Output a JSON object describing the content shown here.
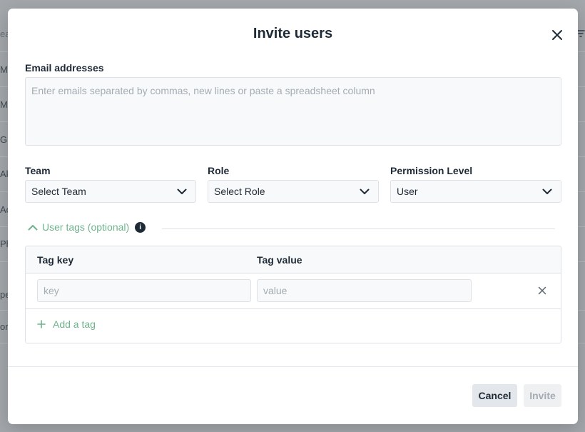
{
  "background": {
    "rows": [
      "eau",
      "Mo",
      "Ma",
      "Gu",
      "Ak",
      "Ac",
      "Ph",
      "pe",
      "on"
    ]
  },
  "modal": {
    "title": "Invite users",
    "email": {
      "label": "Email addresses",
      "placeholder": "Enter emails separated by commas, new lines or paste a spreadsheet column",
      "value": ""
    },
    "team": {
      "label": "Team",
      "value": "Select Team"
    },
    "role": {
      "label": "Role",
      "value": "Select Role"
    },
    "permission": {
      "label": "Permission Level",
      "value": "User"
    },
    "tags": {
      "toggle_label": "User tags (optional)",
      "info_glyph": "i",
      "key_header": "Tag key",
      "value_header": "Tag value",
      "key_placeholder": "key",
      "value_placeholder": "value",
      "add_label": "Add a tag"
    },
    "buttons": {
      "cancel": "Cancel",
      "invite": "Invite"
    }
  },
  "colors": {
    "accent": "#6fb38c",
    "text": "#1f2a37",
    "border": "#dde1e6",
    "field_bg": "#f8f9fa",
    "disabled_text": "#a4abb3"
  },
  "icons": {
    "close": "close-icon",
    "dropdown": "chevron-down-icon",
    "collapse": "chevron-up-icon",
    "info": "info-icon",
    "add": "plus-icon",
    "remove": "close-icon",
    "filter": "filter-icon"
  }
}
